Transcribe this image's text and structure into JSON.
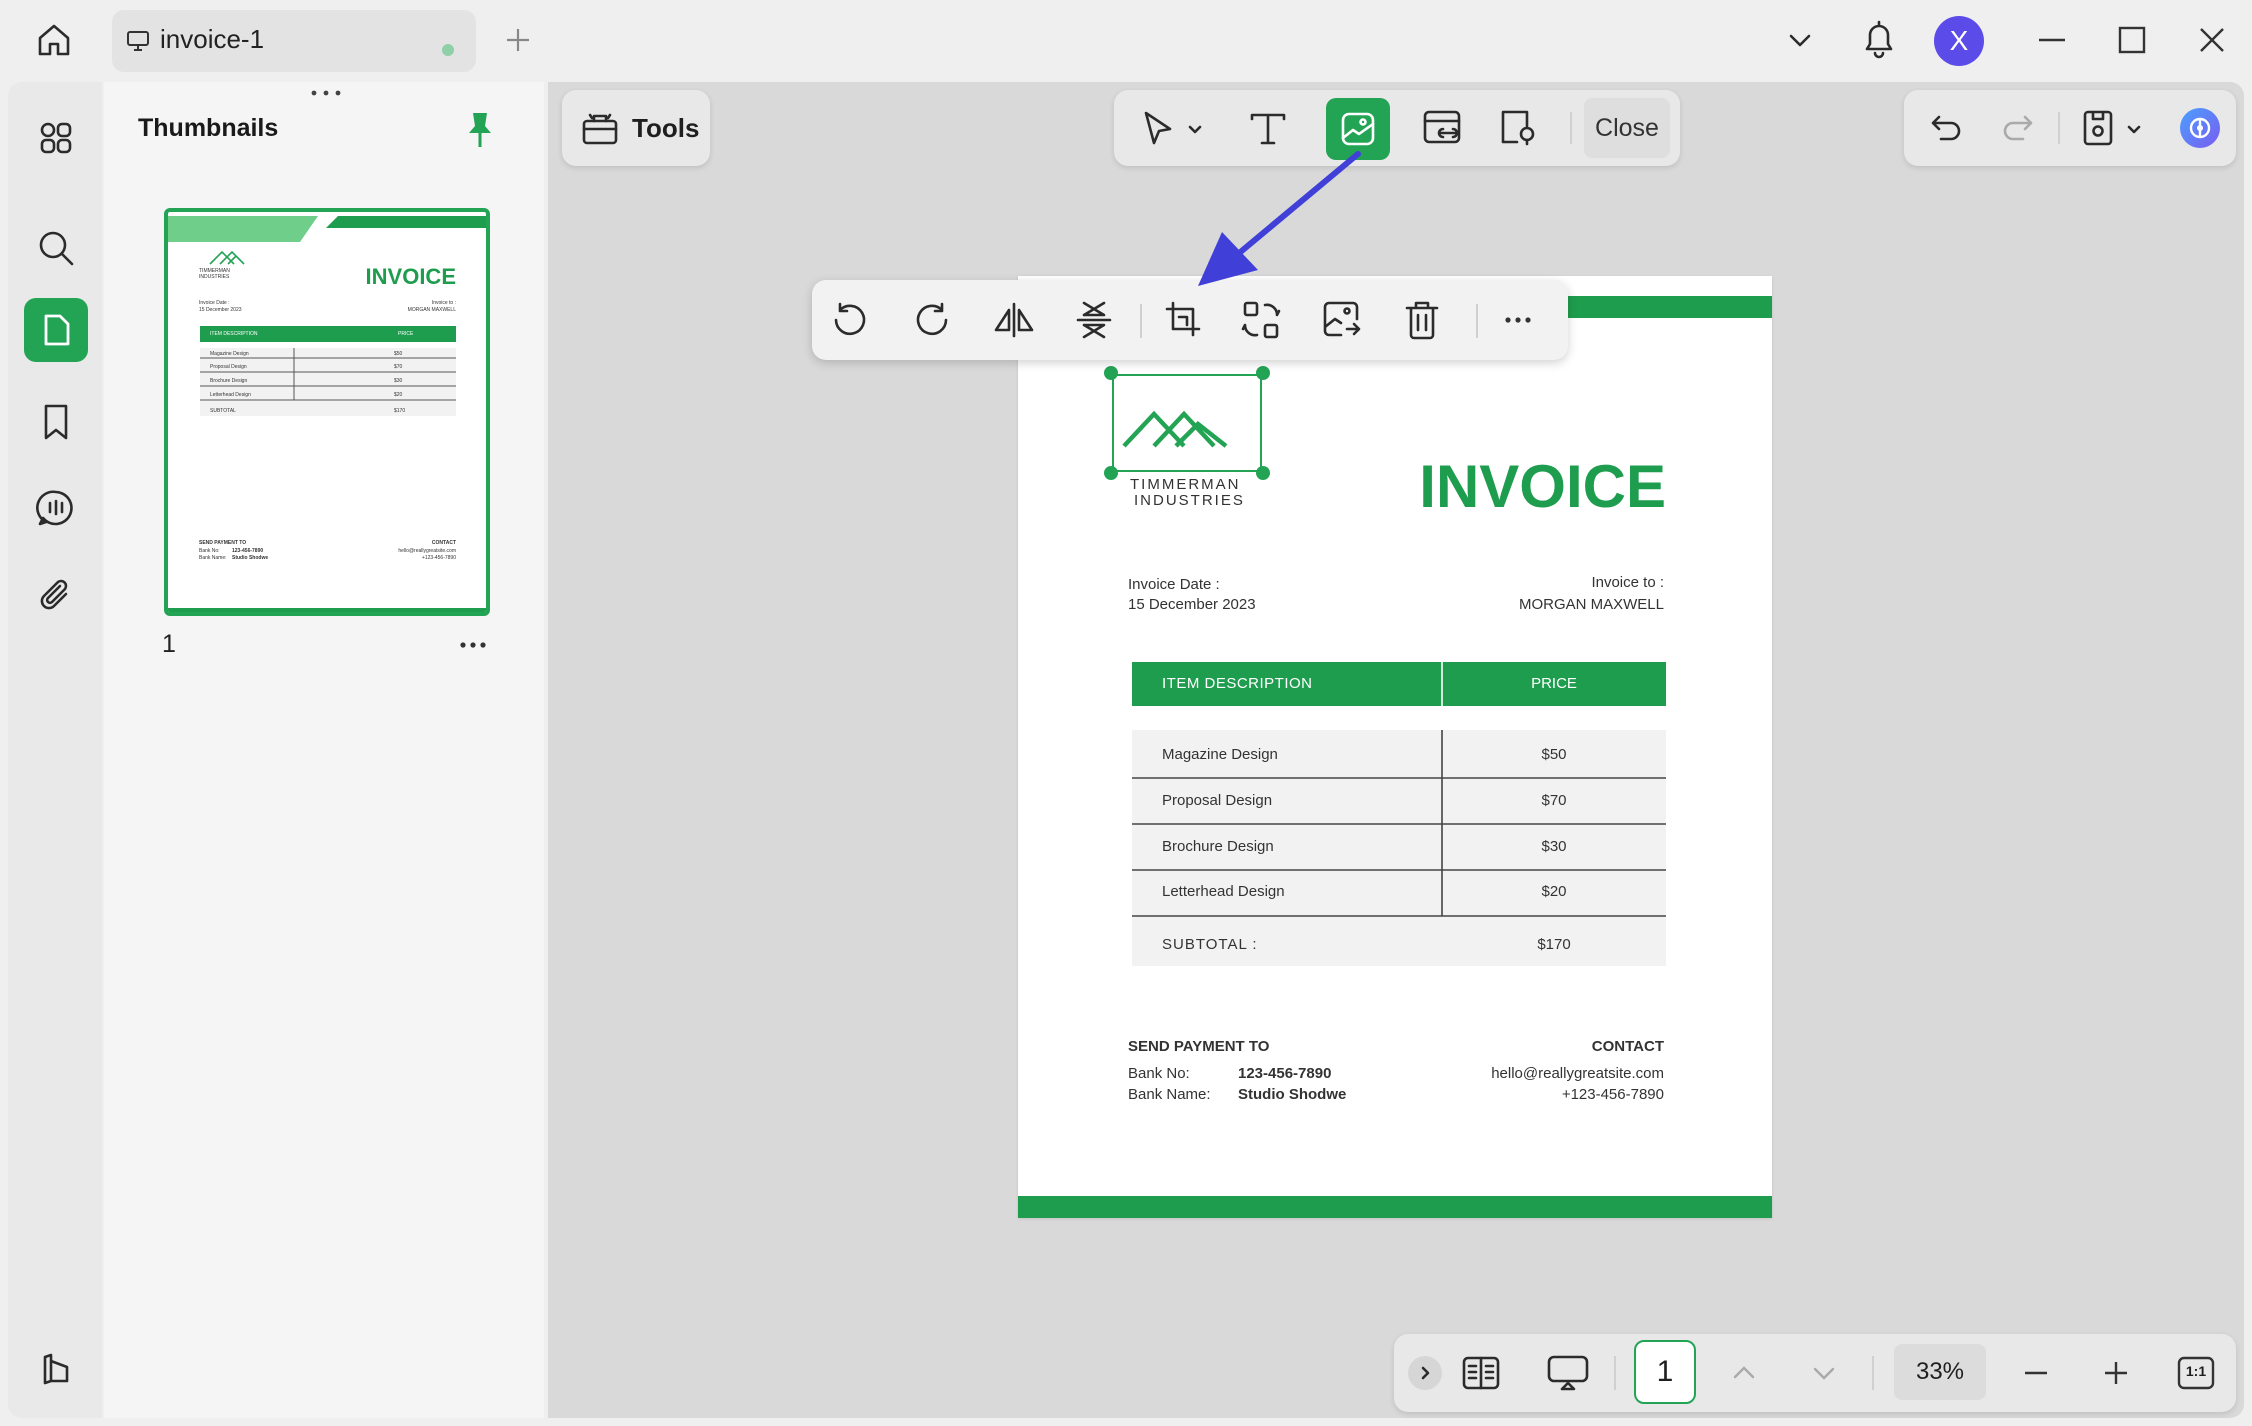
{
  "window": {
    "tab_title": "invoice-1",
    "avatar_initial": "X"
  },
  "sidebar": {
    "title": "Thumbnails",
    "page_number": "1",
    "icons": [
      "grid-icon",
      "search-icon",
      "pages-icon",
      "bookmark-icon",
      "comment-icon",
      "attachment-icon",
      "collapse-icon"
    ]
  },
  "toolbar": {
    "tools_label": "Tools",
    "close_label": "Close"
  },
  "image_toolbar": {
    "icons": [
      "rotate-left-icon",
      "rotate-right-icon",
      "flip-horizontal-icon",
      "flip-vertical-icon",
      "crop-icon",
      "replace-icon",
      "extract-icon",
      "delete-icon",
      "more-icon"
    ]
  },
  "invoice": {
    "company_line1": "TIMMERMAN",
    "company_line2": "INDUSTRIES",
    "title": "INVOICE",
    "date_label": "Invoice Date :",
    "date_value": "15 December 2023",
    "to_label": "Invoice to :",
    "to_value": "MORGAN MAXWELL",
    "col_desc": "ITEM DESCRIPTION",
    "col_price": "PRICE",
    "items": [
      {
        "desc": "Magazine Design",
        "price": "$50"
      },
      {
        "desc": "Proposal Design",
        "price": "$70"
      },
      {
        "desc": "Brochure Design",
        "price": "$30"
      },
      {
        "desc": "Letterhead Design",
        "price": "$20"
      }
    ],
    "subtotal_label": "SUBTOTAL :",
    "subtotal_value": "$170",
    "payment_heading": "SEND PAYMENT TO",
    "bank_no_label": "Bank No:",
    "bank_no_value": "123-456-7890",
    "bank_name_label": "Bank Name:",
    "bank_name_value": "Studio Shodwe",
    "contact_heading": "CONTACT",
    "contact_email": "hello@reallygreatsite.com",
    "contact_phone": "+123-456-7890"
  },
  "thumb": {
    "title": "INVOICE",
    "company": "TIMMERMAN INDUSTRIES",
    "date_label": "Invoice Date :",
    "date_value": "15 December 2023",
    "to_label": "Invoice to :",
    "to_value": "MORGAN MAXWELL",
    "col_desc": "ITEM DESCRIPTION",
    "col_price": "PRICE",
    "items": [
      {
        "desc": "Magazine Design",
        "price": "$50"
      },
      {
        "desc": "Proposal Design",
        "price": "$70"
      },
      {
        "desc": "Brochure Design",
        "price": "$30"
      },
      {
        "desc": "Letterhead Design",
        "price": "$20"
      }
    ],
    "subtotal_label": "SUBTOTAL",
    "subtotal_value": "$170",
    "payment_heading": "SEND PAYMENT TO",
    "bank_no_label": "Bank No:",
    "bank_no_value": "123-456-7890",
    "bank_name_label": "Bank Name:",
    "bank_name_value": "Studio Shodwe",
    "contact_heading": "CONTACT",
    "contact_email": "hello@reallygreatsite.com",
    "contact_phone": "+123-456-7890"
  },
  "bottombar": {
    "current_page": "1",
    "zoom": "33%",
    "fit_label": "1:1"
  },
  "colors": {
    "accent": "#23a455",
    "arrow": "#4040d8",
    "avatar": "#5b4be8"
  }
}
